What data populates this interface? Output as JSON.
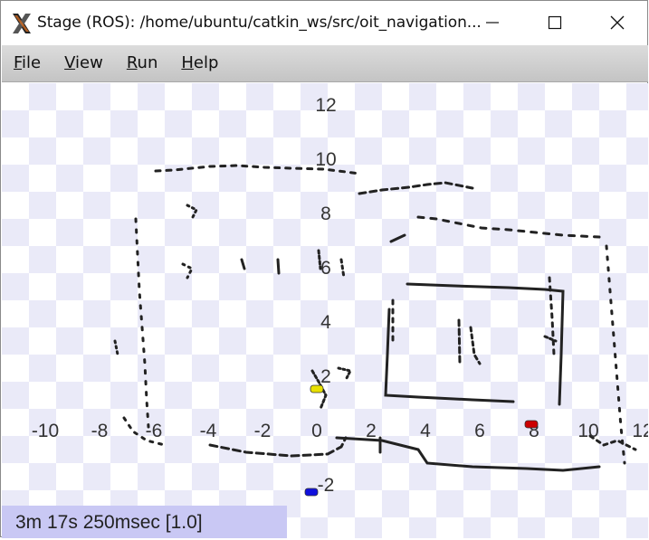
{
  "window": {
    "title": "Stage (ROS): /home/ubuntu/catkin_ws/src/oit_navigation...",
    "icon": "x-window-icon",
    "controls": [
      "minimize-icon",
      "maximize-icon",
      "close-icon"
    ]
  },
  "menu": [
    {
      "first": "F",
      "rest": "ile"
    },
    {
      "first": "V",
      "rest": "iew"
    },
    {
      "first": "R",
      "rest": "un"
    },
    {
      "first": "H",
      "rest": "elp"
    }
  ],
  "axes": {
    "x_ticks": [
      "-10",
      "-8",
      "-6",
      "-4",
      "-2",
      "0",
      "2",
      "4",
      "6",
      "8",
      "10",
      "12"
    ],
    "y_ticks": [
      "12",
      "10",
      "8",
      "6",
      "4",
      "2",
      "-2"
    ]
  },
  "robots": [
    {
      "color": "#e8e000",
      "x": 0,
      "y": 1.5
    },
    {
      "color": "#cc0000",
      "x": 7.9,
      "y": 0.2
    },
    {
      "color": "#1010dd",
      "x": -0.2,
      "y": -2.3
    }
  ],
  "status": {
    "text": "3m 17s 250msec [1.0]"
  },
  "colors": {
    "checker": "#eaeaf8",
    "status_bg": "#c9c8f4",
    "obstacles": "#222222"
  }
}
